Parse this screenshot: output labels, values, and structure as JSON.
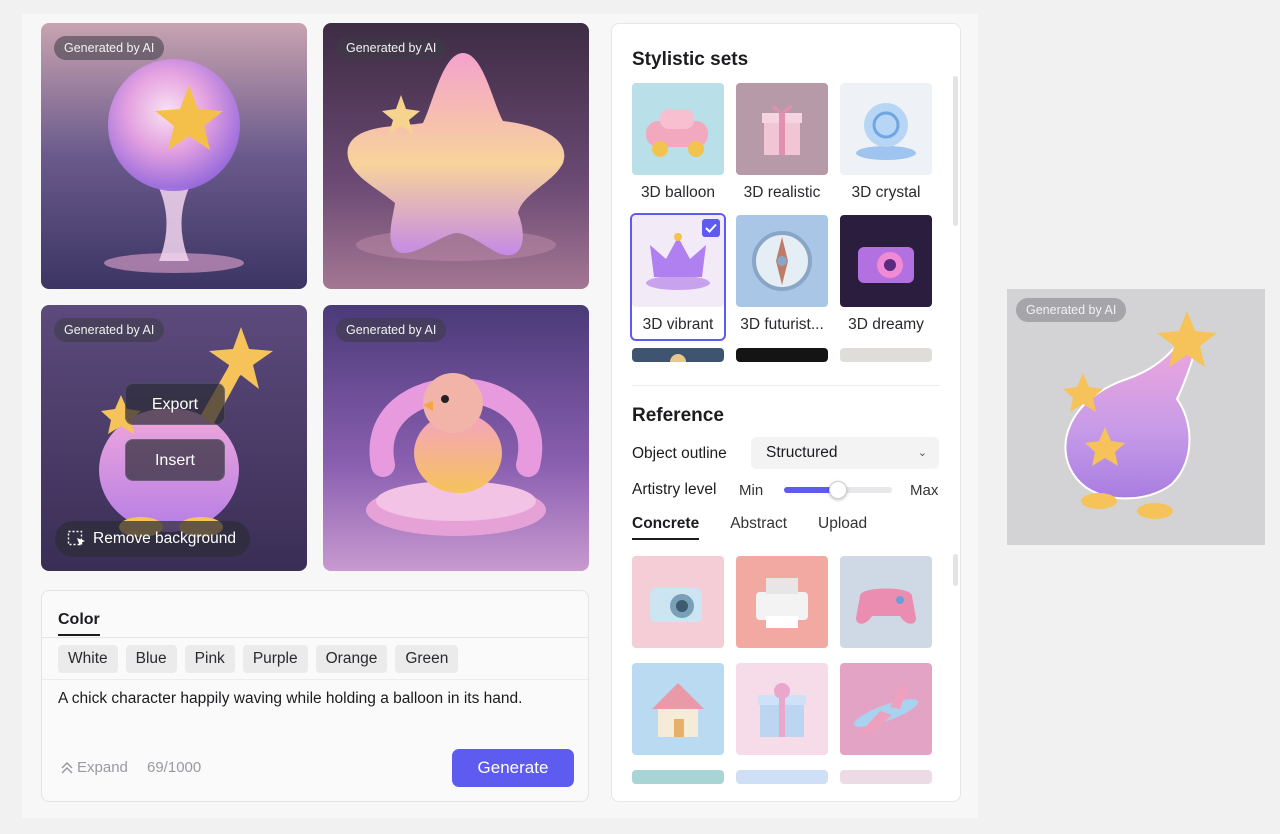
{
  "ai_badge": "Generated by AI",
  "hover_actions": {
    "export": "Export",
    "insert": "Insert",
    "remove_bg": "Remove background"
  },
  "prompt": {
    "tab": "Color",
    "colors": [
      "White",
      "Blue",
      "Pink",
      "Purple",
      "Orange",
      "Green"
    ],
    "text": "A chick character happily waving while holding a balloon in its hand.",
    "expand": "Expand",
    "counter": "69/1000",
    "generate": "Generate"
  },
  "stylistic": {
    "title": "Stylistic sets",
    "items": [
      {
        "label": "3D balloon"
      },
      {
        "label": "3D realistic"
      },
      {
        "label": "3D crystal"
      },
      {
        "label": "3D vibrant",
        "selected": true
      },
      {
        "label": "3D futurist..."
      },
      {
        "label": "3D dreamy"
      }
    ]
  },
  "reference": {
    "title": "Reference",
    "outline_label": "Object outline",
    "outline_value": "Structured",
    "artistry_label": "Artistry level",
    "min": "Min",
    "max": "Max",
    "artistry_value": 0.5,
    "tabs": [
      "Concrete",
      "Abstract",
      "Upload"
    ],
    "active_tab": "Concrete"
  },
  "colors": {
    "accent": "#5d5bf0"
  }
}
